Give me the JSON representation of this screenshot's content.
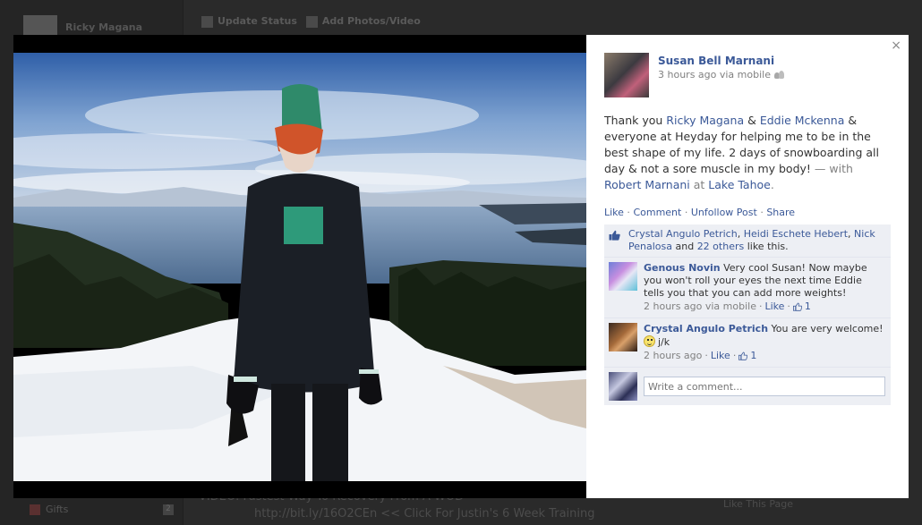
{
  "background": {
    "user_name": "Ricky Magana",
    "top_actions": [
      "Update Status",
      "Add Photos/Video"
    ],
    "gifts_label": "Gifts",
    "gifts_count": "2",
    "feed_line1": "VIDEO: Fastest Way To Recovery From A WOD",
    "feed_line2": "http://bit.ly/16O2CEn << Click For Justin's 6 Week Training",
    "like_page": "Like This Page"
  },
  "viewer": {
    "close_label": "×",
    "author": {
      "name": "Susan Bell Marnani",
      "time": "3 hours ago via mobile"
    },
    "caption": {
      "p1": "Thank you ",
      "tag1": "Ricky Magana",
      "p2": " & ",
      "tag2": "Eddie Mckenna",
      "p3": " & everyone at Heyday for helping me to be in the best shape of my life. 2 days of snowboarding all day & not a sore muscle in my body!",
      "with": " — with ",
      "tag3": "Robert Marnani",
      "at": " at ",
      "place": "Lake Tahoe",
      "end": "."
    },
    "actions": {
      "like": "Like",
      "comment": "Comment",
      "unfollow": "Unfollow Post",
      "share": "Share",
      "sep": " · "
    },
    "likes": {
      "names": [
        "Crystal Angulo Petrich",
        "Heidi Eschete Hebert",
        "Nick Penalosa"
      ],
      "and": " and ",
      "others": "22 others",
      "tail": " like this.",
      "comma": ", "
    },
    "comments": [
      {
        "name": "Genous Novin",
        "text": " Very cool Susan! Now maybe you won't roll your eyes the next time Eddie tells you that you can add more weights!",
        "time": "2 hours ago via mobile",
        "like": "Like",
        "likes": "1"
      },
      {
        "name": "Crystal Angulo Petrich",
        "text": " You are very welcome!",
        "text2": "j/k",
        "time": "2 hours ago",
        "like": "Like",
        "likes": "1"
      }
    ],
    "write_placeholder": "Write a comment..."
  }
}
